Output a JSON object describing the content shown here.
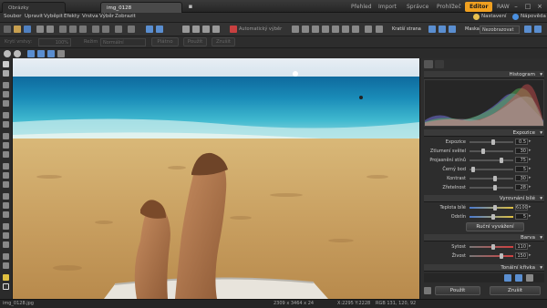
{
  "tabs": [
    {
      "label": "Obrázky"
    },
    {
      "label": "img_0128"
    }
  ],
  "modes": [
    {
      "label": "Přehled"
    },
    {
      "label": "Import"
    },
    {
      "label": "Správce"
    },
    {
      "label": "Prohlížeč"
    },
    {
      "label": "Editor"
    },
    {
      "label": "RAW"
    }
  ],
  "window_controls": {
    "minimize": "–",
    "maximize": "□",
    "close": "×"
  },
  "menu": [
    "Soubor",
    "Upravit",
    "Vyběpit",
    "Efekty",
    "Vrstva",
    "Výběr",
    "Zobrazit"
  ],
  "toolbar": {
    "settings_label": "Nastavení",
    "help_label": "Nápověda",
    "auto_label": "Automatický výběr",
    "crop_label": "Kratší strana",
    "mask_label": "Maska:",
    "mask_value": "Nezobrazovat"
  },
  "toolbar2": {
    "opacity_label": "Krytí vrstvy:",
    "opacity_value": "100%",
    "blend_label": "Režim",
    "blend_value": "Normální",
    "layer_btn": "Plátno",
    "apply_btn": "Použít",
    "cancel_btn": "Zrušit"
  },
  "status": {
    "filename": "img_0128.jpg",
    "dimensions": "2309 x 3464 x 24",
    "coords": "X:2295 Y:2228",
    "rgb": "RGB 131, 120, 92"
  },
  "panel": {
    "histogram_title": "Histogram",
    "exposure_title": "Expozice",
    "exposure_sliders": [
      {
        "name": "Expozice",
        "value": "0.5",
        "fraction": 0.55
      },
      {
        "name": "Ztlumení světel",
        "value": "30",
        "fraction": 0.3
      },
      {
        "name": "Projasnění stínů",
        "value": "75",
        "fraction": 0.75
      },
      {
        "name": "Černý bod",
        "value": "5",
        "fraction": 0.05
      },
      {
        "name": "Kontrast",
        "value": "30",
        "fraction": 0.6
      },
      {
        "name": "Zřetelnost",
        "value": "28",
        "fraction": 0.6
      }
    ],
    "wb_title": "Vyrovnání bílé",
    "wb_sliders": [
      {
        "name": "Teplota bílé",
        "value": "6100",
        "fraction": 0.6
      },
      {
        "name": "Odstín",
        "value": "5",
        "fraction": 0.55
      }
    ],
    "wb_manual": "Ruční vyvážení",
    "color_title": "Barva",
    "color_sliders": [
      {
        "name": "Sytost",
        "value": "110",
        "fraction": 0.55
      },
      {
        "name": "Živost",
        "value": "150",
        "fraction": 0.75
      }
    ],
    "curve_title": "Tonální křivka",
    "apply_label": "Použít",
    "cancel_label": "Zrušit"
  },
  "colors": {
    "accent": "#f0a020",
    "panel_bg": "#2d2d2d",
    "toolbar_bg": "#333333"
  }
}
